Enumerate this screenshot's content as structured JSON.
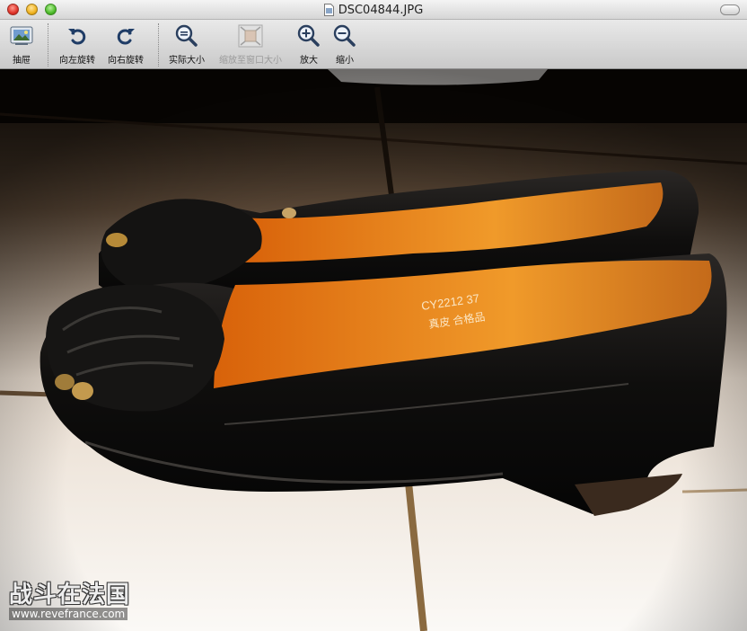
{
  "window": {
    "title": "DSC04844.JPG",
    "file_icon": "jpeg-document-icon"
  },
  "toolbar": {
    "items": [
      {
        "label": "抽屉",
        "icon": "drawer-icon",
        "enabled": true
      },
      {
        "label": "向左旋转",
        "icon": "rotate-left-icon",
        "enabled": true
      },
      {
        "label": "向右旋转",
        "icon": "rotate-right-icon",
        "enabled": true
      },
      {
        "label": "实际大小",
        "icon": "actual-size-icon",
        "enabled": true
      },
      {
        "label": "缩放至窗口大小",
        "icon": "zoom-to-fit-icon",
        "enabled": false
      },
      {
        "label": "放大",
        "icon": "zoom-in-icon",
        "enabled": true
      },
      {
        "label": "缩小",
        "icon": "zoom-out-icon",
        "enabled": true
      }
    ]
  },
  "image": {
    "watermark_title": "战斗在法国",
    "watermark_url": "www.revefrance.com"
  },
  "colors": {
    "toolbar_top": "#e9e9e9",
    "toolbar_bottom": "#c9c9c9",
    "shoe_lining": "#e07a12",
    "shoe_leather": "#0e0d0c"
  }
}
